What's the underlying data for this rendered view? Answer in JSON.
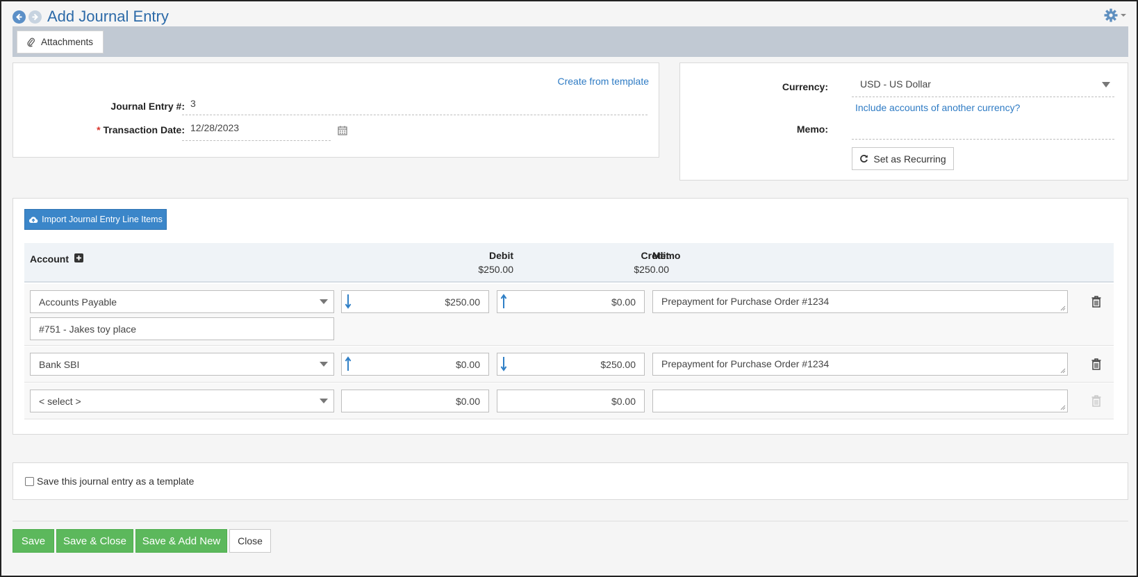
{
  "header": {
    "title": "Add Journal Entry"
  },
  "attachments_tab": {
    "label": "Attachments"
  },
  "left_panel": {
    "create_from_template": "Create from template",
    "journal_entry_label": "Journal Entry #:",
    "journal_entry_value": "3",
    "transaction_date_required": "*",
    "transaction_date_label": "Transaction Date:",
    "transaction_date_value": "12/28/2023"
  },
  "right_panel": {
    "currency_label": "Currency:",
    "currency_value": "USD - US Dollar",
    "include_accounts_link": "Include accounts of another currency?",
    "memo_label": "Memo:",
    "memo_value": "",
    "recurring_button": "Set as Recurring"
  },
  "lines": {
    "import_button": "Import Journal Entry Line Items",
    "columns": {
      "account": "Account",
      "debit": "Debit",
      "debit_total": "$250.00",
      "credit": "Credit",
      "credit_total": "$250.00",
      "memo": "Memo"
    },
    "rows": [
      {
        "account": "Accounts Payable",
        "sub_account": "#751 - Jakes toy place",
        "debit": "$250.00",
        "credit": "$0.00",
        "memo": "Prepayment for Purchase Order #1234"
      },
      {
        "account": "Bank SBI",
        "debit": "$0.00",
        "credit": "$250.00",
        "memo": "Prepayment for Purchase Order #1234"
      },
      {
        "account": "< select >",
        "debit": "$0.00",
        "credit": "$0.00",
        "memo": ""
      }
    ]
  },
  "template_option": {
    "label": "Save this journal entry as a template",
    "checked": false
  },
  "footer": {
    "save": "Save",
    "save_close": "Save & Close",
    "save_add_new": "Save & Add New",
    "close": "Close"
  },
  "colors": {
    "title_blue": "#2c6aa8",
    "link_blue": "#2e7bc4",
    "button_blue": "#3b86c9",
    "button_green": "#5cb85c",
    "arrow_blue": "#2f7fc6",
    "attachments_bar": "#c1c9d3"
  }
}
